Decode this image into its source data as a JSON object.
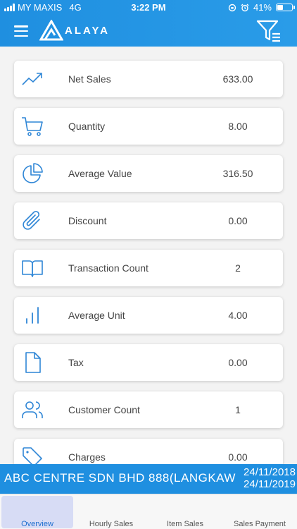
{
  "status_bar": {
    "carrier": "MY MAXIS",
    "network": "4G",
    "time": "3:22 PM",
    "battery_percent": "41%",
    "battery_level": 0.41
  },
  "app_bar": {
    "brand": "ALAYA",
    "menu_icon": "hamburger-icon",
    "filter_icon": "filter-icon"
  },
  "metrics": [
    {
      "label": "Net Sales",
      "value": "633.00",
      "icon": "trend-up-icon"
    },
    {
      "label": "Quantity",
      "value": "8.00",
      "icon": "cart-icon"
    },
    {
      "label": "Average Value",
      "value": "316.50",
      "icon": "pie-chart-icon"
    },
    {
      "label": "Discount",
      "value": "0.00",
      "icon": "paperclip-icon"
    },
    {
      "label": "Transaction Count",
      "value": "2",
      "icon": "book-icon"
    },
    {
      "label": "Average Unit",
      "value": "4.00",
      "icon": "bar-chart-icon"
    },
    {
      "label": "Tax",
      "value": "0.00",
      "icon": "document-icon"
    },
    {
      "label": "Customer Count",
      "value": "1",
      "icon": "users-icon"
    },
    {
      "label": "Charges",
      "value": "0.00",
      "icon": "tag-icon"
    }
  ],
  "company": {
    "name": "ABC CENTRE SDN BHD 888(LANGKAWI",
    "date_from": "24/11/2018",
    "date_to": "24/11/2019"
  },
  "tabs": [
    {
      "label": "Overview",
      "active": true
    },
    {
      "label": "Hourly Sales",
      "active": false
    },
    {
      "label": "Item Sales",
      "active": false
    },
    {
      "label": "Sales Payment",
      "active": false
    }
  ],
  "colors": {
    "primary": "#1f8fe0",
    "icon": "#2f86d6",
    "active_tab_bg": "#d7dcf5"
  }
}
